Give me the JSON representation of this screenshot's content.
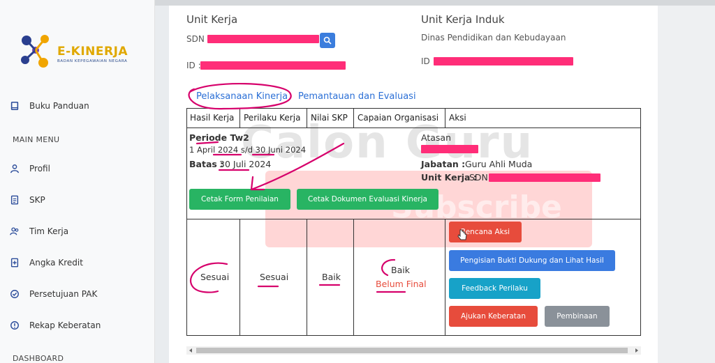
{
  "app": {
    "brand_name": "E-KINERJA",
    "brand_sub": "BADAN KEPEGAWAIAN NEGARA"
  },
  "sidebar": {
    "items": [
      {
        "label": "Buku Panduan",
        "icon": "book-icon"
      },
      {
        "label": "Profil",
        "icon": "user-icon"
      },
      {
        "label": "SKP",
        "icon": "document-icon"
      },
      {
        "label": "Tim Kerja",
        "icon": "team-icon"
      },
      {
        "label": "Angka Kredit",
        "icon": "plus-doc-icon"
      },
      {
        "label": "Persetujuan PAK",
        "icon": "check-circle-icon"
      },
      {
        "label": "Rekap Keberatan",
        "icon": "alert-circle-icon"
      }
    ],
    "section_main": "MAIN MENU",
    "section_dashboard": "DASHBOARD"
  },
  "unit": {
    "unit_kerja_label": "Unit Kerja",
    "unit_kerja_prefix": "SDN",
    "id_label": "ID :",
    "induk_label": "Unit Kerja Induk",
    "induk_value": "Dinas Pendidikan dan Kebudayaan",
    "induk_id_label": "ID :"
  },
  "tabs": {
    "pelaksanaan": "Pelaksanaan Kinerja",
    "pemantauan": "Pemantauan dan Evaluasi"
  },
  "table": {
    "headers": [
      "Hasil Kerja",
      "Perilaku Kerja",
      "Nilai SKP",
      "Capaian Organisasi",
      "Aksi"
    ],
    "periode_label": "Periode Tw2",
    "periode_range": "1 April 2024 s/d 30 Juni 2024",
    "batas_label": "Batas :",
    "batas_value": "30 Juli 2024",
    "atasan_label": "Atasan",
    "jabatan_label": "Jabatan :",
    "jabatan_value": "Guru Ahli Muda",
    "unit_label": "Unit Kerja :",
    "unit_value": "SDN",
    "cetak_form": "Cetak Form Penilaian",
    "cetak_dokumen": "Cetak Dokumen Evaluasi Kinerja",
    "hasil_kerja": "Sesuai",
    "perilaku_kerja": "Sesuai",
    "nilai_skp": "Baik",
    "capaian": "Baik",
    "capaian_status": "Belum Final",
    "actions": {
      "rencana": "Rencana Aksi",
      "pengisian": "Pengisian Bukti Dukung dan Lihat Hasil",
      "feedback": "Feedback Perilaku",
      "ajukan": "Ajukan Keberatan",
      "pembinaan": "Pembinaan"
    }
  },
  "watermark": {
    "channel": "Calon Guru",
    "subscribe": "Subscribe"
  },
  "colors": {
    "accent_blue": "#2b6fd6",
    "green": "#28b463",
    "red": "#e74c3c",
    "cyan": "#17a2c8",
    "annotation": "#d6006b"
  }
}
